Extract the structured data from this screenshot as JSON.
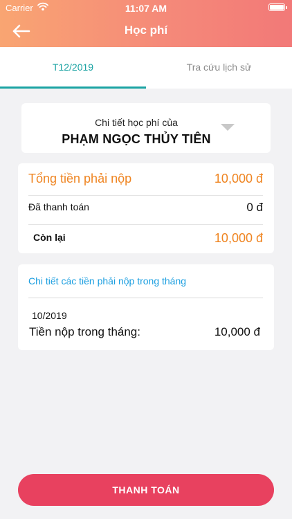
{
  "status_bar": {
    "carrier": "Carrier",
    "time": "11:07 AM"
  },
  "header": {
    "title": "Học phí",
    "icons": {
      "back": "back-arrow-icon"
    }
  },
  "tabs": [
    {
      "label": "T12/2019",
      "active": true
    },
    {
      "label": "Tra cứu lịch sử",
      "active": false
    }
  ],
  "student_selector": {
    "label": "Chi tiết học phí của",
    "name": "PHẠM NGỌC THỦY TIÊN",
    "icon": "dropdown-arrow-icon"
  },
  "summary": {
    "total_label": "Tổng tiền phải nộp",
    "total_value": "10,000 đ",
    "paid_label": "Đã thanh toán",
    "paid_value": "0 đ",
    "remaining_label": "Còn lại",
    "remaining_value": "10,000 đ"
  },
  "detail": {
    "title": "Chi tiết các tiền phải nộp trong tháng",
    "month": "10/2019",
    "item_label": "Tiền nộp trong tháng:",
    "item_value": "10,000 đ"
  },
  "actions": {
    "pay_label": "THANH TOÁN"
  },
  "colors": {
    "header_gradient_start": "#f9a572",
    "header_gradient_end": "#f27978",
    "accent_teal": "#1aa3a3",
    "amount_orange": "#ef8522",
    "link_blue": "#1a9ee0",
    "pay_button": "#e8415f",
    "background": "#f2f2f4"
  }
}
